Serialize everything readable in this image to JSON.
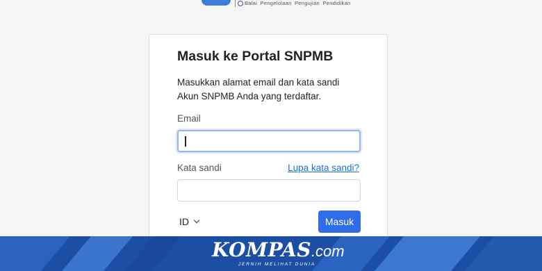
{
  "top_logo": {
    "org_text": "Balai Pengelolaan Pengujian Pendidikan"
  },
  "card": {
    "title": "Masuk ke Portal SNPMB",
    "description": "Masukkan alamat email dan kata sandi Akun SNPMB Anda yang terdaftar.",
    "email_label": "Email",
    "email_value": "",
    "password_label": "Kata sandi",
    "forgot_link": "Lupa kata sandi?",
    "password_value": "",
    "language": "ID",
    "submit_label": "Masuk"
  },
  "watermark": {
    "brand": "KOMPAS",
    "brand_suffix": ".com",
    "tagline": "JERNIH MELIHAT DUNIA"
  },
  "colors": {
    "primary_button": "#2f6ee8",
    "link": "#1a6fe0",
    "banner": "#1c4fa3"
  }
}
